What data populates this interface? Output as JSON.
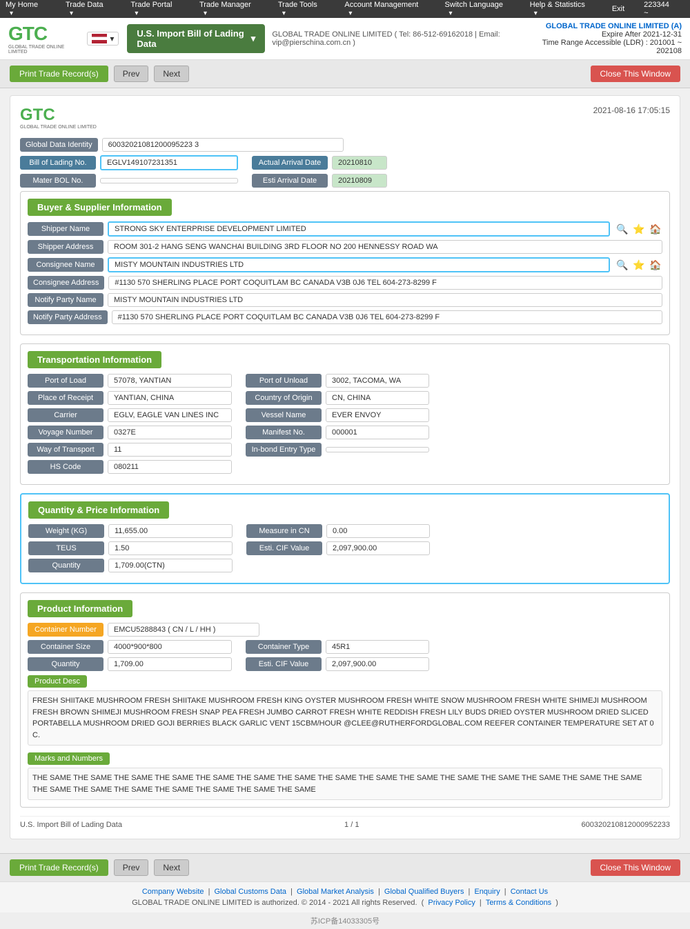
{
  "topNav": {
    "userId": "223344 ~",
    "items": [
      "My Home",
      "Trade Data",
      "Trade Portal",
      "Trade Manager",
      "Trade Tools",
      "Account Management",
      "Switch Language",
      "Help & Statistics",
      "Exit"
    ]
  },
  "header": {
    "logoLine1": "GTC",
    "logoLine2": "GLOBAL TRADE ONLINE LIMITED",
    "contactInfo": "GLOBAL TRADE ONLINE LIMITED ( Tel: 86-512-69162018 | Email: vip@pierschina.com.cn )",
    "billSelector": "U.S. Import Bill of Lading Data",
    "accountName": "GLOBAL TRADE ONLINE LIMITED (A)",
    "expireAfter": "Expire After 2021-12-31",
    "timeRange": "Time Range Accessible (LDR) : 201001 ~ 202108"
  },
  "actionBar": {
    "printLabel": "Print Trade Record(s)",
    "prevLabel": "Prev",
    "nextLabel": "Next",
    "closeLabel": "Close This Window"
  },
  "record": {
    "date": "2021-08-16 17:05:15",
    "globalDataIdentity": {
      "label": "Global Data Identity",
      "value": "60032021081200095223 3"
    },
    "billOfLading": {
      "label": "Bill of Lading No.",
      "value": "EGLV149107231351"
    },
    "actualArrivalDate": {
      "label": "Actual Arrival Date",
      "value": "20210810"
    },
    "materBOL": {
      "label": "Mater BOL No.",
      "value": ""
    },
    "estiArrivalDate": {
      "label": "Esti Arrival Date",
      "value": "20210809"
    }
  },
  "buyerSupplier": {
    "sectionTitle": "Buyer & Supplier Information",
    "shipperName": {
      "label": "Shipper Name",
      "value": "STRONG SKY ENTERPRISE DEVELOPMENT LIMITED"
    },
    "shipperAddress": {
      "label": "Shipper Address",
      "value": "ROOM 301-2 HANG SENG WANCHAI BUILDING 3RD FLOOR NO 200 HENNESSY ROAD WA"
    },
    "consigneeName": {
      "label": "Consignee Name",
      "value": "MISTY MOUNTAIN INDUSTRIES LTD"
    },
    "consigneeAddress": {
      "label": "Consignee Address",
      "value": "#1130 570 SHERLING PLACE PORT COQUITLAM BC CANADA V3B 0J6 TEL 604-273-8299 F"
    },
    "notifyPartyName": {
      "label": "Notify Party Name",
      "value": "MISTY MOUNTAIN INDUSTRIES LTD"
    },
    "notifyPartyAddress": {
      "label": "Notify Party Address",
      "value": "#1130 570 SHERLING PLACE PORT COQUITLAM BC CANADA V3B 0J6 TEL 604-273-8299 F"
    }
  },
  "transportation": {
    "sectionTitle": "Transportation Information",
    "portOfLoad": {
      "label": "Port of Load",
      "value": "57078, YANTIAN"
    },
    "portOfUnload": {
      "label": "Port of Unload",
      "value": "3002, TACOMA, WA"
    },
    "placeOfReceipt": {
      "label": "Place of Receipt",
      "value": "YANTIAN, CHINA"
    },
    "countryOfOrigin": {
      "label": "Country of Origin",
      "value": "CN, CHINA"
    },
    "carrier": {
      "label": "Carrier",
      "value": "EGLV, EAGLE VAN LINES INC"
    },
    "vesselName": {
      "label": "Vessel Name",
      "value": "EVER ENVOY"
    },
    "voyageNumber": {
      "label": "Voyage Number",
      "value": "0327E"
    },
    "manifestNo": {
      "label": "Manifest No.",
      "value": "000001"
    },
    "wayOfTransport": {
      "label": "Way of Transport",
      "value": "11"
    },
    "inBondEntryType": {
      "label": "In-bond Entry Type",
      "value": ""
    },
    "hsCode": {
      "label": "HS Code",
      "value": "080211"
    }
  },
  "quantityPrice": {
    "sectionTitle": "Quantity & Price Information",
    "weight": {
      "label": "Weight (KG)",
      "value": "11,655.00"
    },
    "measureInCN": {
      "label": "Measure in CN",
      "value": "0.00"
    },
    "teus": {
      "label": "TEUS",
      "value": "1.50"
    },
    "estiCIFValue": {
      "label": "Esti. CIF Value",
      "value": "2,097,900.00"
    },
    "quantity": {
      "label": "Quantity",
      "value": "1,709.00(CTN)"
    }
  },
  "productInfo": {
    "sectionTitle": "Product Information",
    "containerNumber": {
      "label": "Container Number",
      "value": "EMCU5288843 ( CN / L / HH )"
    },
    "containerSize": {
      "label": "Container Size",
      "value": "4000*900*800"
    },
    "containerType": {
      "label": "Container Type",
      "value": "45R1"
    },
    "quantity": {
      "label": "Quantity",
      "value": "1,709.00"
    },
    "estiCIFValue": {
      "label": "Esti. CIF Value",
      "value": "2,097,900.00"
    },
    "productDescLabel": "Product Desc",
    "productDescText": "FRESH SHIITAKE MUSHROOM FRESH SHIITAKE MUSHROOM FRESH KING OYSTER MUSHROOM FRESH WHITE SNOW MUSHROOM FRESH WHITE SHIMEJI MUSHROOM FRESH BROWN SHIMEJI MUSHROOM FRESH SNAP PEA FRESH JUMBO CARROT FRESH WHITE REDDISH FRESH LILY BUDS DRIED OYSTER MUSHROOM DRIED SLICED PORTABELLA MUSHROOM DRIED GOJI BERRIES BLACK GARLIC VENT 15CBM/HOUR @CLEE@RUTHERFORDGLOBAL.COM REEFER CONTAINER TEMPERATURE SET AT 0 C.",
    "marksLabel": "Marks and Numbers",
    "marksText": "THE SAME THE SAME THE SAME THE SAME THE SAME THE SAME THE SAME THE SAME THE SAME THE SAME THE SAME THE SAME THE SAME THE SAME THE SAME THE SAME THE SAME THE SAME THE SAME THE SAME THE SAME THE SAME"
  },
  "cardFooter": {
    "leftText": "U.S. Import Bill of Lading Data",
    "pageInfo": "1 / 1",
    "rightText": "600320210812000952233"
  },
  "bottomActionBar": {
    "printLabel": "Print Trade Record(s)",
    "prevLabel": "Prev",
    "nextLabel": "Next",
    "closeLabel": "Close This Window"
  },
  "siteFooter": {
    "links": [
      "Company Website",
      "Global Customs Data",
      "Global Market Analysis",
      "Global Qualified Buyers",
      "Enquiry",
      "Contact Us"
    ],
    "copyright": "GLOBAL TRADE ONLINE LIMITED is authorized. © 2014 - 2021 All rights Reserved.",
    "privacyPolicy": "Privacy Policy",
    "termsConditions": "Terms & Conditions",
    "icpNumber": "苏ICP备14033305号"
  }
}
